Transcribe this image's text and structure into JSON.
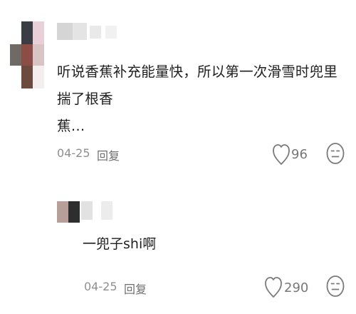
{
  "comment": {
    "text_line1": "听说香蕉补充能量快，所以第一次滑雪时兜里揣了根香",
    "text_line2": "蕉…",
    "date": "04-25",
    "reply_label": "回复",
    "like_count": "96"
  },
  "reply": {
    "text": "一兜子shi啊",
    "date": "04-25",
    "reply_label": "回复",
    "like_count": "290"
  },
  "colors": {
    "text": "#1f1f1f",
    "meta": "#8f8f8f",
    "icon": "#7a7a7a"
  }
}
